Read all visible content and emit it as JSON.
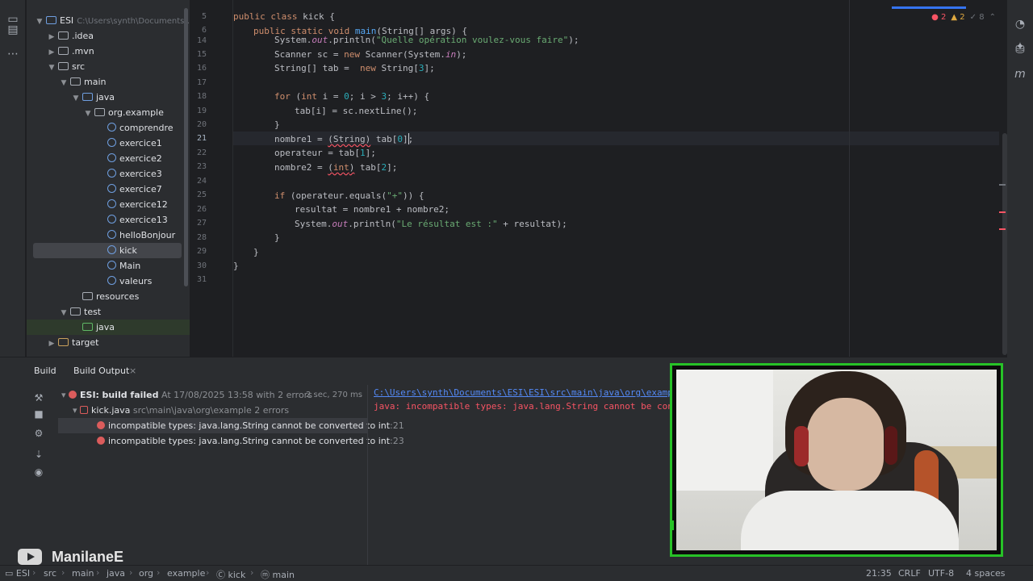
{
  "project_tree": {
    "root": {
      "label": "ESI",
      "path": "C:\\Users\\synth\\Documents\\..."
    },
    "items": [
      {
        "label": ".idea"
      },
      {
        "label": ".mvn"
      },
      {
        "label": "src"
      },
      {
        "label": "main"
      },
      {
        "label": "java"
      },
      {
        "label": "org.example"
      },
      {
        "label": "comprendre"
      },
      {
        "label": "exercice1"
      },
      {
        "label": "exercice2"
      },
      {
        "label": "exercice3"
      },
      {
        "label": "exercice7"
      },
      {
        "label": "exercice12"
      },
      {
        "label": "exercice13"
      },
      {
        "label": "helloBonjour"
      },
      {
        "label": "kick"
      },
      {
        "label": "Main"
      },
      {
        "label": "valeurs"
      },
      {
        "label": "resources"
      },
      {
        "label": "test"
      },
      {
        "label": "java"
      },
      {
        "label": "target"
      }
    ]
  },
  "editor": {
    "error_count": "2",
    "warning_count": "2",
    "check_count": "8",
    "lines": [
      {
        "n": "5",
        "text": "public class kick {"
      },
      {
        "n": "6",
        "text": "public static void main(String[] args) {"
      },
      {
        "n": "14",
        "text": "System.out.println(\"Quelle opération voulez-vous faire\");"
      },
      {
        "n": "15",
        "text": "Scanner sc = new Scanner(System.in);"
      },
      {
        "n": "16",
        "text": "String[] tab =  new String[3];"
      },
      {
        "n": "17",
        "text": ""
      },
      {
        "n": "18",
        "text": "for (int i = 0; i > 3; i++) {"
      },
      {
        "n": "19",
        "text": "tab[i] = sc.nextLine();"
      },
      {
        "n": "20",
        "text": "}"
      },
      {
        "n": "21",
        "text": "nombre1 = (String) tab[0];"
      },
      {
        "n": "22",
        "text": "operateur = tab[1];"
      },
      {
        "n": "23",
        "text": "nombre2 = (int) tab[2];"
      },
      {
        "n": "24",
        "text": ""
      },
      {
        "n": "25",
        "text": "if (operateur.equals(\"+\")) {"
      },
      {
        "n": "26",
        "text": "resultat = nombre1 + nombre2;"
      },
      {
        "n": "27",
        "text": "System.out.println(\"Le résultat est :\" + resultat);"
      },
      {
        "n": "28",
        "text": "}"
      },
      {
        "n": "29",
        "text": "}"
      },
      {
        "n": "30",
        "text": "}"
      },
      {
        "n": "31",
        "text": ""
      }
    ]
  },
  "build": {
    "tab_build": "Build",
    "tab_output": "Build Output",
    "root_label": "ESI:",
    "root_status": "build failed",
    "root_detail": "At 17/08/2025 13:58 with 2 errors",
    "root_time": "2 sec, 270 ms",
    "file_label": "kick.java",
    "file_detail": "src\\main\\java\\org\\example 2 errors",
    "errors": [
      {
        "text": "incompatible types: java.lang.String cannot be converted to int",
        "line": ":21"
      },
      {
        "text": "incompatible types: java.lang.String cannot be converted to int",
        "line": ":23"
      }
    ],
    "output_link": "C:\\Users\\synth\\Documents\\ESI\\ESI\\src\\main\\java\\org\\example",
    "output_error": "java: incompatible types: java.lang.String cannot be conve"
  },
  "watermark": {
    "text": "ManilaneE"
  },
  "status_bar": {
    "breadcrumbs": [
      "ESI",
      "src",
      "main",
      "java",
      "org",
      "example",
      "kick",
      "main"
    ],
    "position": "21:35",
    "line_ending": "CRLF",
    "encoding": "UTF-8",
    "indent": "4 spaces"
  },
  "colors": {
    "accent": "#3574f0",
    "error": "#f75464",
    "webcam_border": "#27c227"
  }
}
